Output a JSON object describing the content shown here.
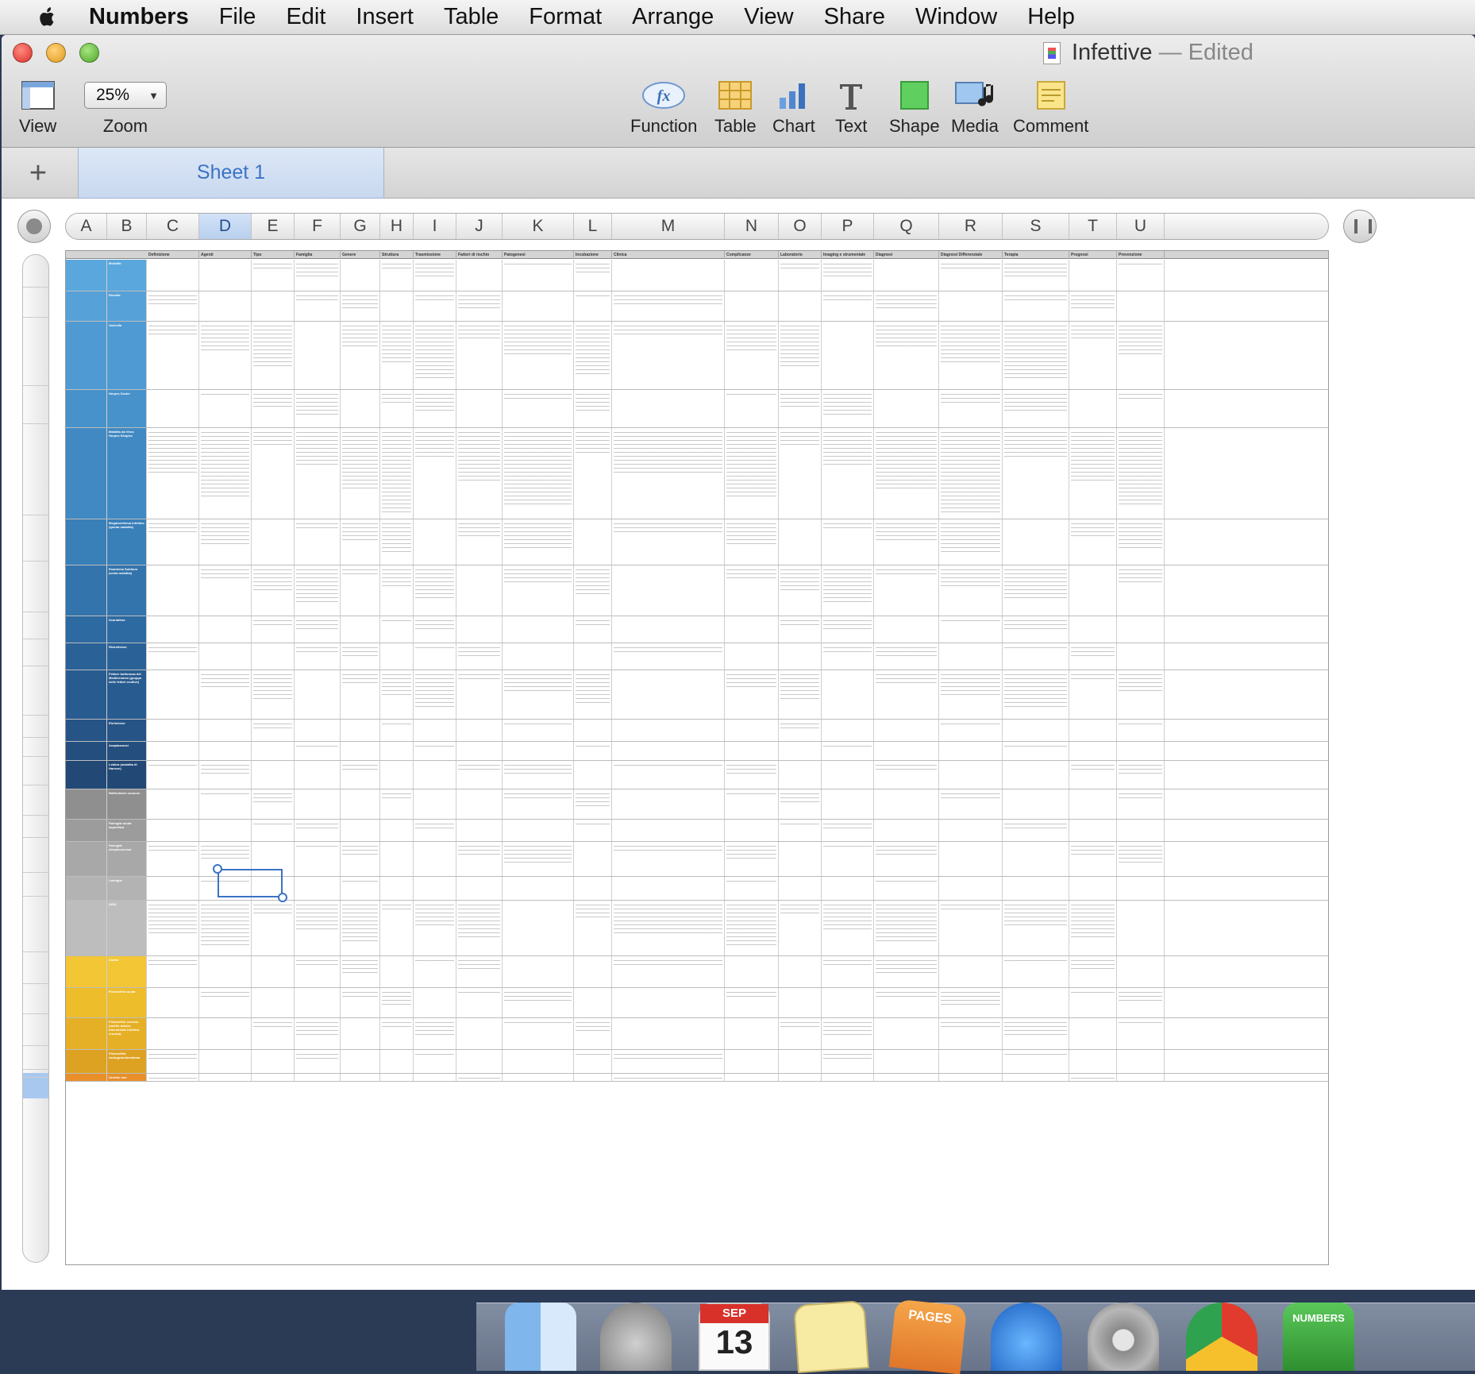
{
  "menubar": {
    "app": "Numbers",
    "items": [
      "File",
      "Edit",
      "Insert",
      "Table",
      "Format",
      "Arrange",
      "View",
      "Share",
      "Window",
      "Help"
    ]
  },
  "window": {
    "title": "Infettive",
    "edited": "— Edited"
  },
  "toolbar": {
    "view_label": "View",
    "zoom_label": "Zoom",
    "zoom_value": "25%",
    "function_label": "Function",
    "table_label": "Table",
    "chart_label": "Chart",
    "text_label": "Text",
    "shape_label": "Shape",
    "media_label": "Media",
    "comment_label": "Comment"
  },
  "sheet_tabs": {
    "add": "+",
    "active": "Sheet 1"
  },
  "columns": [
    "A",
    "B",
    "C",
    "D",
    "E",
    "F",
    "G",
    "H",
    "I",
    "J",
    "K",
    "L",
    "M",
    "N",
    "O",
    "P",
    "Q",
    "R",
    "S",
    "T",
    "U"
  ],
  "selected_column": "D",
  "table": {
    "headers": [
      "Definizione",
      "Agenti",
      "Tipo",
      "Famiglia",
      "Genere",
      "Struttura",
      "Trasmissione",
      "Fattori di rischio",
      "Patogenesi",
      "Incubazione",
      "Clinica",
      "Complicanze",
      "Laboratorio",
      "Imaging e strumentale",
      "Diagnosi",
      "Diagnosi Differenziale",
      "Terapia",
      "Prognosi",
      "Prevenzione"
    ],
    "rows": [
      {
        "name": "Morbillo",
        "color": "#5aa7de"
      },
      {
        "name": "Rosolia",
        "color": "#56a1d8"
      },
      {
        "name": "Varicella",
        "color": "#4f9ad2"
      },
      {
        "name": "Herpes Zoster",
        "color": "#4892cb"
      },
      {
        "name": "Malattia da Virus Herpes Simplex",
        "color": "#4089c2"
      },
      {
        "name": "Megaloeritema infettivo (quinta malattia)",
        "color": "#397fb8"
      },
      {
        "name": "Esantema Subitum (sesta malattia)",
        "color": "#3374ac"
      },
      {
        "name": "Scarlattina",
        "color": "#2d6aa1"
      },
      {
        "name": "Rickettsiosi",
        "color": "#2a6298"
      },
      {
        "name": "Febbre bottonosa del Mediterraneo (gruppo delle febbri eruttive)",
        "color": "#285b8f"
      },
      {
        "name": "Ehrlichiosi",
        "color": "#265486"
      },
      {
        "name": "Anaplasmosi",
        "color": "#244e7e"
      },
      {
        "name": "Lebbra (malattia di Hansen)",
        "color": "#224876"
      },
      {
        "name": "Raffreddore comune",
        "color": "#8f8f8f"
      },
      {
        "name": "Faringite acuta aspecifica",
        "color": "#9c9c9c"
      },
      {
        "name": "Faringite streptococcica",
        "color": "#a8a8a8"
      },
      {
        "name": "Laringite",
        "color": "#b3b3b3"
      },
      {
        "name": "AIDS",
        "color": "#bdbdbd"
      },
      {
        "name": "Cistite",
        "color": "#f2c634"
      },
      {
        "name": "Pielonefrite acuta",
        "color": "#edbd2c"
      },
      {
        "name": "Pielonefrite cronica (nefrite tubulo-interstiziale infettiva cronica)",
        "color": "#e6b026"
      },
      {
        "name": "Pielonefrite xantogranulomatosa",
        "color": "#dea222"
      },
      {
        "name": "Uretrite non",
        "color": "#e88f2a"
      }
    ]
  },
  "dock": {
    "calendar_month": "SEP",
    "calendar_day": "13",
    "pages_label": "PAGES",
    "numbers_label": "NUMBERS"
  }
}
